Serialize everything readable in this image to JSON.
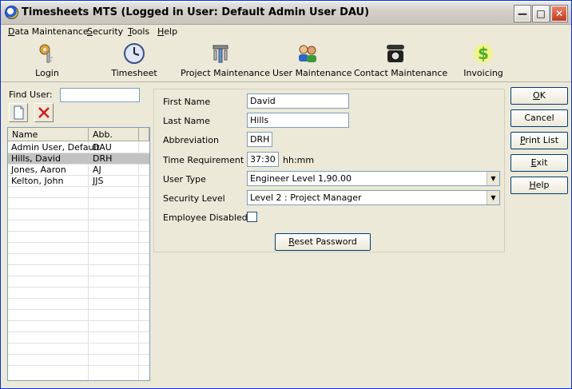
{
  "window": {
    "title": "Timesheets MTS (Logged in User: Default Admin User DAU)"
  },
  "menu": [
    {
      "label": "Data Maintenance",
      "u": "D",
      "rest": "ata Maintenance"
    },
    {
      "label": "Security",
      "u": "S",
      "rest": "ecurity"
    },
    {
      "label": "Tools",
      "u": "T",
      "rest": "ools"
    },
    {
      "label": "Help",
      "u": "H",
      "rest": "elp"
    }
  ],
  "toolbar": [
    {
      "label": "Login",
      "icon": "keys-icon"
    },
    {
      "label": "Timesheet",
      "icon": "clock-icon"
    },
    {
      "label": "Project Maintenance",
      "icon": "tools-icon"
    },
    {
      "label": "User Maintenance",
      "icon": "users-icon"
    },
    {
      "label": "Contact Maintenance",
      "icon": "phone-icon"
    },
    {
      "label": "Invoicing",
      "icon": "dollar-icon"
    }
  ],
  "find": {
    "label": "Find User:",
    "value": ""
  },
  "list": {
    "headers": [
      "Name",
      "Abb."
    ],
    "rows": [
      {
        "name": "Admin User, Default",
        "abb": "DAU",
        "selected": false
      },
      {
        "name": "Hills, David",
        "abb": "DRH",
        "selected": true
      },
      {
        "name": "Jones, Aaron",
        "abb": "AJ",
        "selected": false
      },
      {
        "name": "Kelton, John",
        "abb": "JJS",
        "selected": false
      }
    ]
  },
  "form": {
    "first_name_label": "First Name",
    "first_name": "David",
    "last_name_label": "Last Name",
    "last_name": "Hills",
    "abbreviation_label": "Abbreviation",
    "abbreviation": "DRH",
    "time_req_label": "Time Requirement",
    "time_req": "37:30",
    "time_unit": "hh:mm",
    "user_type_label": "User Type",
    "user_type": "Engineer Level 1,90.00",
    "security_label": "Security Level",
    "security": "Level 2 : Project Manager",
    "disabled_label": "Employee Disabled",
    "reset_password": {
      "u": "R",
      "rest": "eset Password"
    }
  },
  "buttons": [
    {
      "u": "O",
      "rest": "K"
    },
    {
      "u": "",
      "rest": "Cancel"
    },
    {
      "u": "P",
      "rest": "rint List"
    },
    {
      "u": "E",
      "rest": "xit"
    },
    {
      "u": "H",
      "rest": "elp"
    }
  ]
}
